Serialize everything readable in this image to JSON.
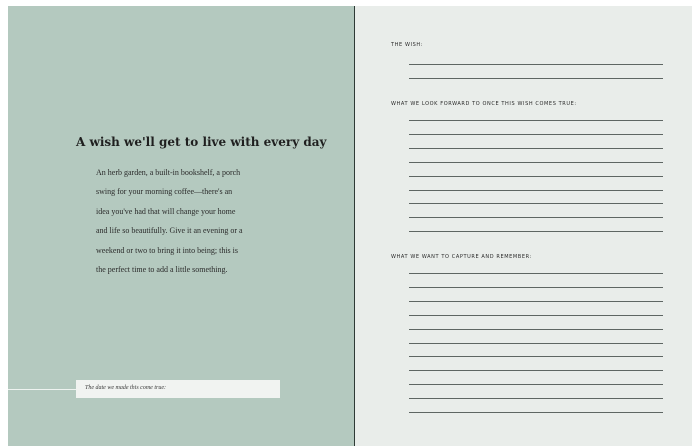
{
  "left_page": {
    "heading": "A wish we'll get to live with every day",
    "paragraph_lines": [
      "An herb garden, a built-in bookshelf, a porch",
      "swing for your morning coffee—there's an",
      "idea you've had that will change your home",
      "and life so beautifully. Give it an evening or a",
      "weekend or two to bring it into being; this is",
      "the perfect time to add a little something."
    ],
    "date_prompt": "The date we made this come true:"
  },
  "right_page": {
    "sections": [
      {
        "label": "THE WISH:",
        "line_count": 2
      },
      {
        "label": "WHAT WE LOOK FORWARD TO ONCE THIS WISH COMES TRUE:",
        "line_count": 9
      },
      {
        "label": "WHAT WE WANT TO CAPTURE AND REMEMBER:",
        "line_count": 11
      }
    ]
  },
  "colors": {
    "left_page_bg": "#b4c9bf",
    "right_page_bg": "#e9edea",
    "rule_line": "#5e6663"
  }
}
